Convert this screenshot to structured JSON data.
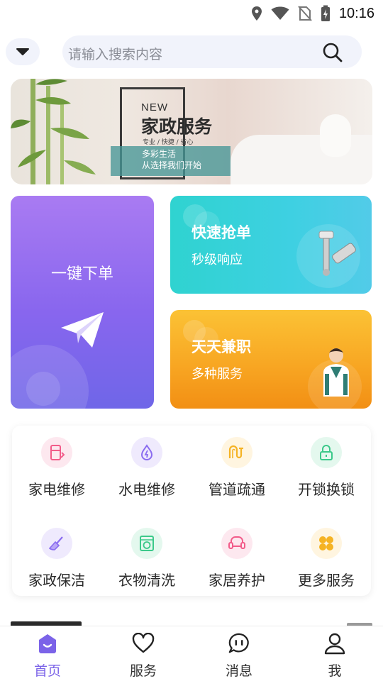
{
  "status_bar": {
    "time": "10:16",
    "icons": [
      "location-icon",
      "wifi-icon",
      "no-sim-icon",
      "battery-charging-icon"
    ]
  },
  "search": {
    "placeholder": "请输入搜索内容",
    "dropdown_icon": "chevron-down-icon",
    "search_icon": "search-icon"
  },
  "banner": {
    "new_label": "NEW",
    "title": "家政服务",
    "subtitle": "专业 / 快捷 / 省心",
    "tagline_1": "多彩生活",
    "tagline_2": "从选择我们开始"
  },
  "cards": {
    "order": {
      "label": "一键下单",
      "icon": "paper-plane-icon"
    },
    "fast": {
      "title": "快速抢单",
      "subtitle": "秒级响应",
      "image": "faucet-image"
    },
    "parttime": {
      "title": "天天兼职",
      "subtitle": "多种服务",
      "image": "housekeeper-image"
    }
  },
  "services": [
    {
      "label": "家电维修",
      "icon": "fridge-repair-icon",
      "color": "#f25c8a",
      "bg": "#fde8ef"
    },
    {
      "label": "水电维修",
      "icon": "water-drop-bolt-icon",
      "color": "#8a6cf0",
      "bg": "#efeafd"
    },
    {
      "label": "管道疏通",
      "icon": "pipe-icon",
      "color": "#f5b324",
      "bg": "#fff5e0"
    },
    {
      "label": "开锁换锁",
      "icon": "lock-icon",
      "color": "#3cc98a",
      "bg": "#e4f8ee"
    },
    {
      "label": "家政保洁",
      "icon": "broom-icon",
      "color": "#8a6cf0",
      "bg": "#efeafd"
    },
    {
      "label": "衣物清洗",
      "icon": "washing-machine-icon",
      "color": "#3cc98a",
      "bg": "#e4f8ee"
    },
    {
      "label": "家居养护",
      "icon": "sofa-icon",
      "color": "#f25c8a",
      "bg": "#fde8ef"
    },
    {
      "label": "更多服务",
      "icon": "more-grid-icon",
      "color": "#f5b324",
      "bg": "#fff5e0"
    }
  ],
  "bottom_nav": [
    {
      "label": "首页",
      "icon": "home-icon",
      "active": true
    },
    {
      "label": "服务",
      "icon": "heart-icon",
      "active": false
    },
    {
      "label": "消息",
      "icon": "message-icon",
      "active": false
    },
    {
      "label": "我",
      "icon": "user-icon",
      "active": false
    }
  ],
  "colors": {
    "accent": "#7b63e8",
    "card_order": "#8866ee",
    "card_fast": "#3ed0e2",
    "card_parttime": "#f8a723"
  }
}
